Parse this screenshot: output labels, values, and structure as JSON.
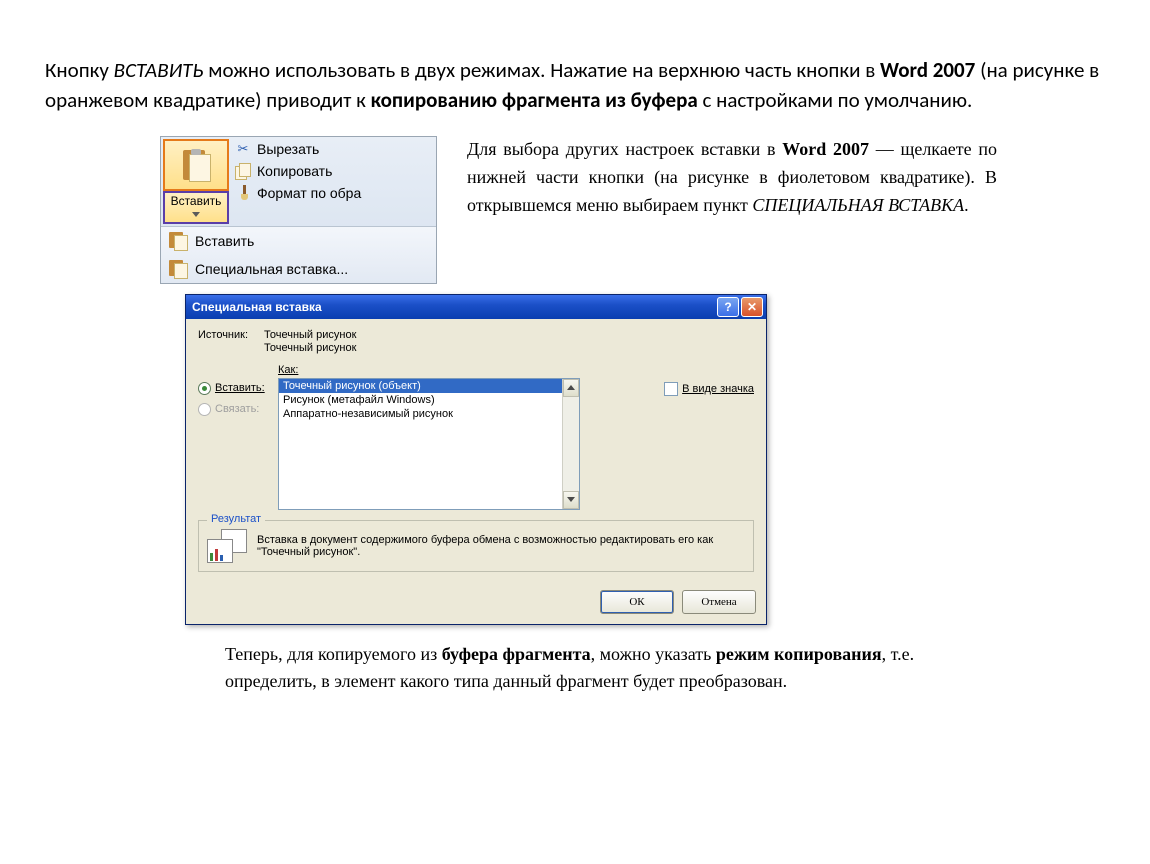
{
  "intro": {
    "p1a": "Кнопку ",
    "p1b": "ВСТАВИТЬ",
    "p1c": " можно использовать в двух режимах. Нажатие на верхнюю часть кнопки в ",
    "p1d": "Word 2007",
    "p1e": " (на рисунке в оранжевом квадратике) приводит к ",
    "p1f": "копированию фрагмента из буфера",
    "p1g": " с настройками по умолчанию."
  },
  "ribbon": {
    "paste_label": "Вставить",
    "cut": "Вырезать",
    "copy": "Копировать",
    "format": "Формат по обра",
    "menu_paste": "Вставить",
    "menu_special": "Специальная вставка..."
  },
  "desc": {
    "a": "Для выбора других настроек вставки в ",
    "b": "Word 2007",
    "c": " — щелкаете по нижней части кнопки (на рисунке в фиолетовом квадратике). В открывшемся меню выбираем пункт ",
    "d": "СПЕЦИАЛЬНАЯ ВСТАВКА",
    "e": "."
  },
  "dialog": {
    "title": "Специальная вставка",
    "source_label": "Источник:",
    "source1": "Точечный рисунок",
    "source2": "Точечный рисунок",
    "how_label": "Как:",
    "radio_paste": "Вставить:",
    "radio_link": "Связать:",
    "opts": [
      "Точечный рисунок (объект)",
      "Рисунок (метафайл Windows)",
      "Аппаратно-независимый рисунок"
    ],
    "as_icon": "В виде значка",
    "result_legend": "Результат",
    "result_text": "Вставка в документ содержимого буфера обмена с возможностью редактировать его как \"Точечный рисунок\".",
    "ok": "ОК",
    "cancel": "Отмена"
  },
  "foot": {
    "a": "Теперь, для копируемого из ",
    "b": "буфера фрагмента",
    "c": ", можно указать ",
    "d": "режим копирования",
    "e": ", т.е. определить, в элемент какого типа данный фрагмент будет преобразован."
  }
}
